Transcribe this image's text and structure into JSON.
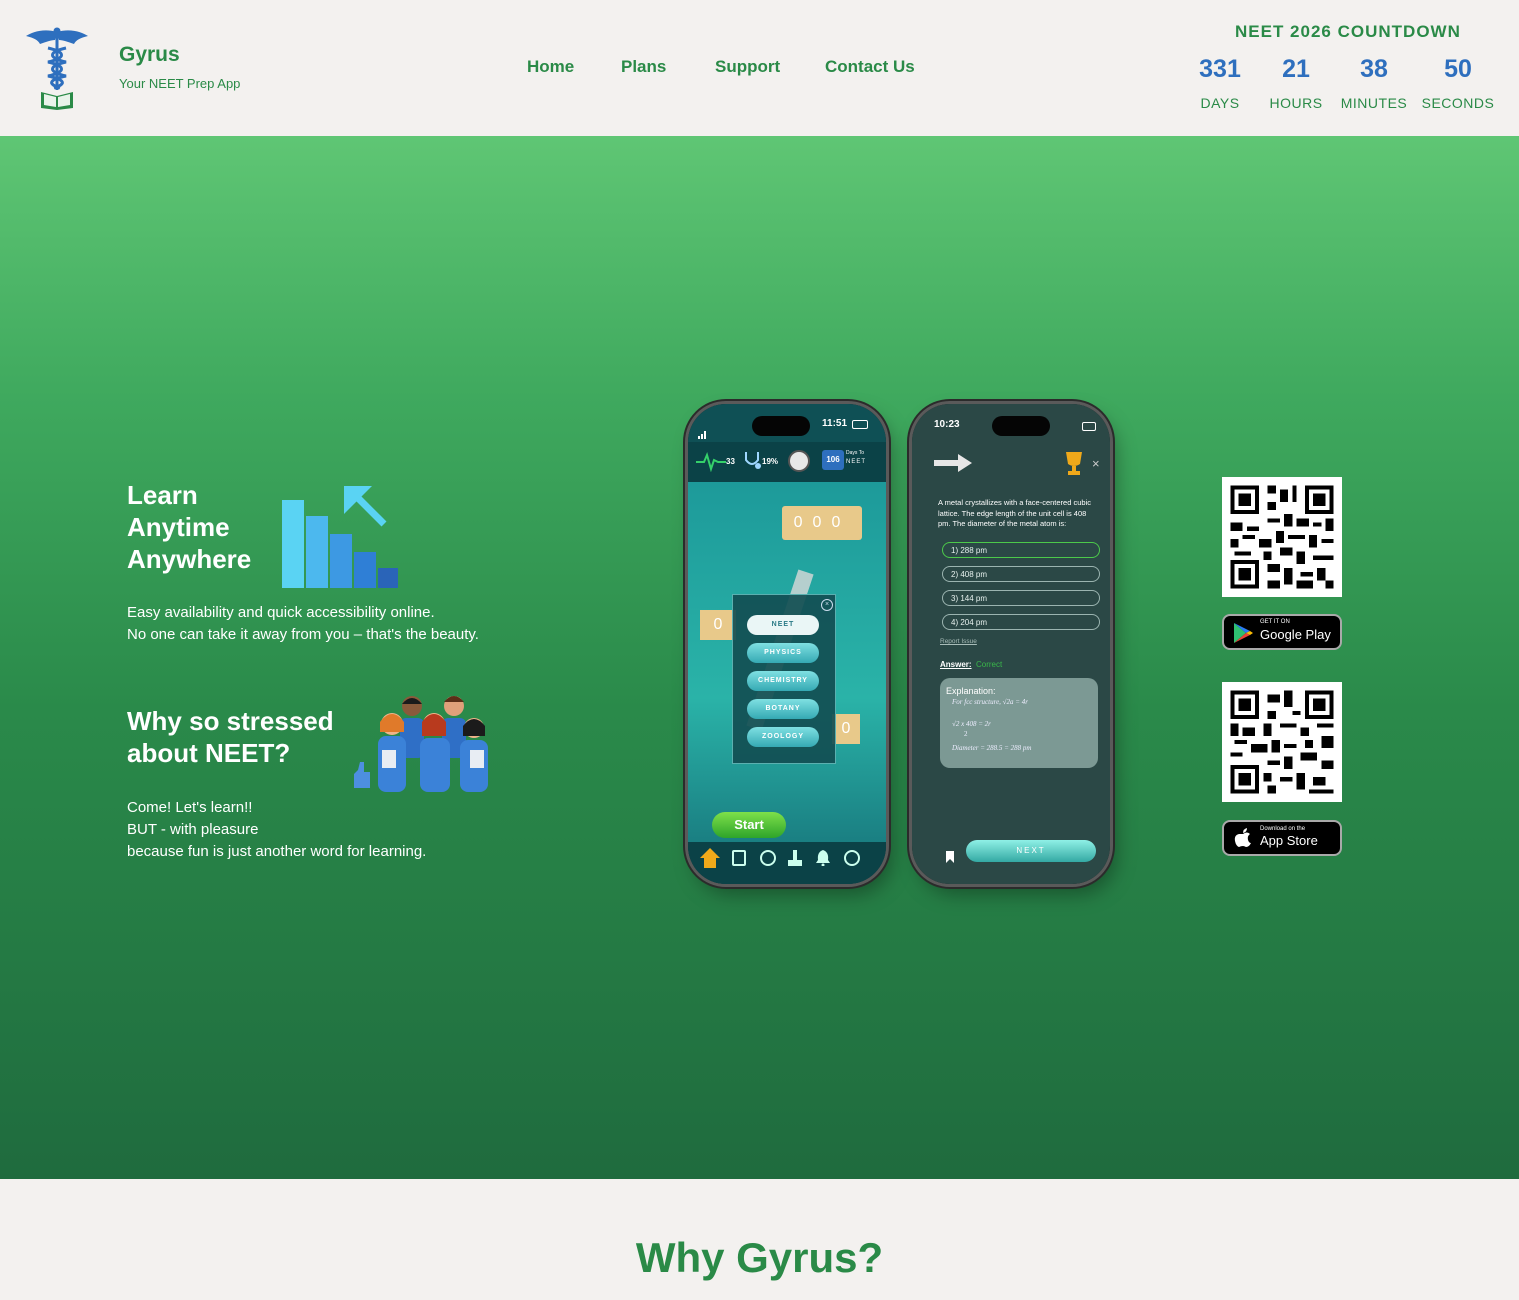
{
  "brand": {
    "name": "Gyrus",
    "tagline": "Your NEET Prep App"
  },
  "nav": {
    "items": [
      "Home",
      "Plans",
      "Support",
      "Contact Us"
    ]
  },
  "countdown": {
    "title": "NEET 2026 COUNTDOWN",
    "units": [
      {
        "value": "331",
        "label": "DAYS"
      },
      {
        "value": "21",
        "label": "HOURS"
      },
      {
        "value": "38",
        "label": "MINUTES"
      },
      {
        "value": "50",
        "label": "SECONDS"
      }
    ]
  },
  "hero": {
    "block1": {
      "heading": [
        "Learn",
        "Anytime",
        "Anywhere"
      ],
      "lines": [
        "Easy availability and quick accessibility online.",
        "No one can take it away from you – that's the beauty."
      ]
    },
    "block2": {
      "heading": [
        "Why so stressed",
        "about NEET?"
      ],
      "lines": [
        "Come! Let's learn!!",
        "BUT - with pleasure",
        "because fun is just another word for learning."
      ]
    }
  },
  "phone1": {
    "time": "11:51",
    "stats": {
      "pulse": "33",
      "percent": "19%",
      "days_count": "106",
      "days_label_top": "Days To",
      "days_label_bottom": "NEET"
    },
    "board_digits": [
      "0",
      "0",
      "0"
    ],
    "side_digit_left": "0",
    "side_digit_right": "0",
    "subjects": [
      "NEET",
      "PHYSICS",
      "CHEMISTRY",
      "BOTANY",
      "ZOOLOGY"
    ],
    "start_label": "Start"
  },
  "phone2": {
    "time": "10:23",
    "question": "A metal crystallizes with a face-centered cubic lattice. The edge length of the unit cell is 408 pm. The diameter of the metal atom is:",
    "options": [
      "1)  288 pm",
      "2)  408 pm",
      "3)  144 pm",
      "4)  204 pm"
    ],
    "report_label": "Report Issue",
    "answer_label": "Answer:",
    "answer_value": "Correct",
    "explanation_title": "Explanation:",
    "explanation_lines": [
      "For fcc structure, √2a = 4r",
      "√2 x 408  = 2r",
      "2",
      "Diameter = 288.5 = 288 pm"
    ],
    "next_label": "NEXT"
  },
  "stores": {
    "google": {
      "small": "GET IT ON",
      "big": "Google Play"
    },
    "apple": {
      "small": "Download on the",
      "big": "App Store"
    }
  },
  "why": {
    "title": "Why Gyrus?"
  },
  "colors": {
    "brand_green": "#2a8a47",
    "countdown_blue": "#2e6fbe",
    "hero_top": "#5fc674",
    "hero_bottom": "#1f6b3e"
  }
}
